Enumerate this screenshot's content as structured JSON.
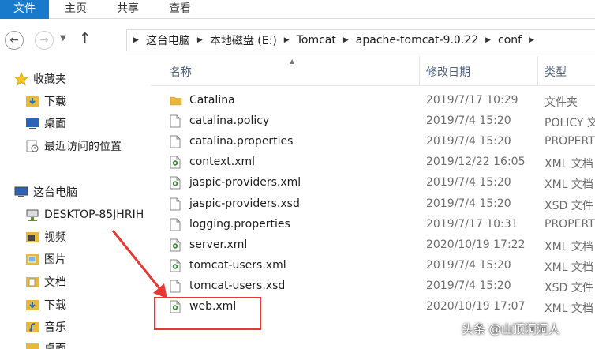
{
  "ribbon": {
    "tabs": [
      "文件",
      "主页",
      "共享",
      "查看"
    ]
  },
  "nav_buttons": {
    "back_icon": "back-arrow",
    "forward_icon": "forward-arrow",
    "recent_icon": "chevron-down",
    "up_icon": "up-arrow"
  },
  "address": {
    "segments": [
      "这台电脑",
      "本地磁盘 (E:)",
      "Tomcat",
      "apache-tomcat-9.0.22",
      "conf"
    ]
  },
  "navpane": {
    "favorites": "收藏夹",
    "downloads": "下载",
    "desktop": "桌面",
    "recent": "最近访问的位置",
    "this_pc": "这台电脑",
    "network_pc": "DESKTOP-85JHRIH",
    "videos": "视频",
    "pictures": "图片",
    "documents": "文档",
    "downloads2": "下载",
    "music": "音乐",
    "desktop2": "桌面"
  },
  "columns": {
    "name": "名称",
    "modified": "修改日期",
    "type": "类型"
  },
  "files": [
    {
      "name": "Catalina",
      "date": "2019/7/17 10:29",
      "type": "文件夹",
      "icon": "folder"
    },
    {
      "name": "catalina.policy",
      "date": "2019/7/4 15:20",
      "type": "POLICY 文",
      "icon": "file"
    },
    {
      "name": "catalina.properties",
      "date": "2019/7/4 15:20",
      "type": "PROPERT",
      "icon": "file"
    },
    {
      "name": "context.xml",
      "date": "2019/12/22 16:05",
      "type": "XML 文档",
      "icon": "xml"
    },
    {
      "name": "jaspic-providers.xml",
      "date": "2019/7/4 15:20",
      "type": "XML 文档",
      "icon": "xml"
    },
    {
      "name": "jaspic-providers.xsd",
      "date": "2019/7/4 15:20",
      "type": "XSD 文件",
      "icon": "file"
    },
    {
      "name": "logging.properties",
      "date": "2019/7/17 10:31",
      "type": "PROPERT",
      "icon": "file"
    },
    {
      "name": "server.xml",
      "date": "2020/10/19 17:22",
      "type": "XML 文档",
      "icon": "xml"
    },
    {
      "name": "tomcat-users.xml",
      "date": "2019/7/4 15:20",
      "type": "XML 文档",
      "icon": "xml"
    },
    {
      "name": "tomcat-users.xsd",
      "date": "2019/7/4 15:20",
      "type": "XSD 文件",
      "icon": "file"
    },
    {
      "name": "web.xml",
      "date": "2020/10/19 17:07",
      "type": "XML 文档",
      "icon": "xml"
    }
  ],
  "annotation": {
    "highlight_target": "web.xml",
    "color": "#e53935"
  },
  "watermark": "头条 @山顶洞洞人",
  "colors": {
    "file_tab": "#1979ca",
    "header_text": "#4c607a",
    "folder": "#e8b83e"
  }
}
